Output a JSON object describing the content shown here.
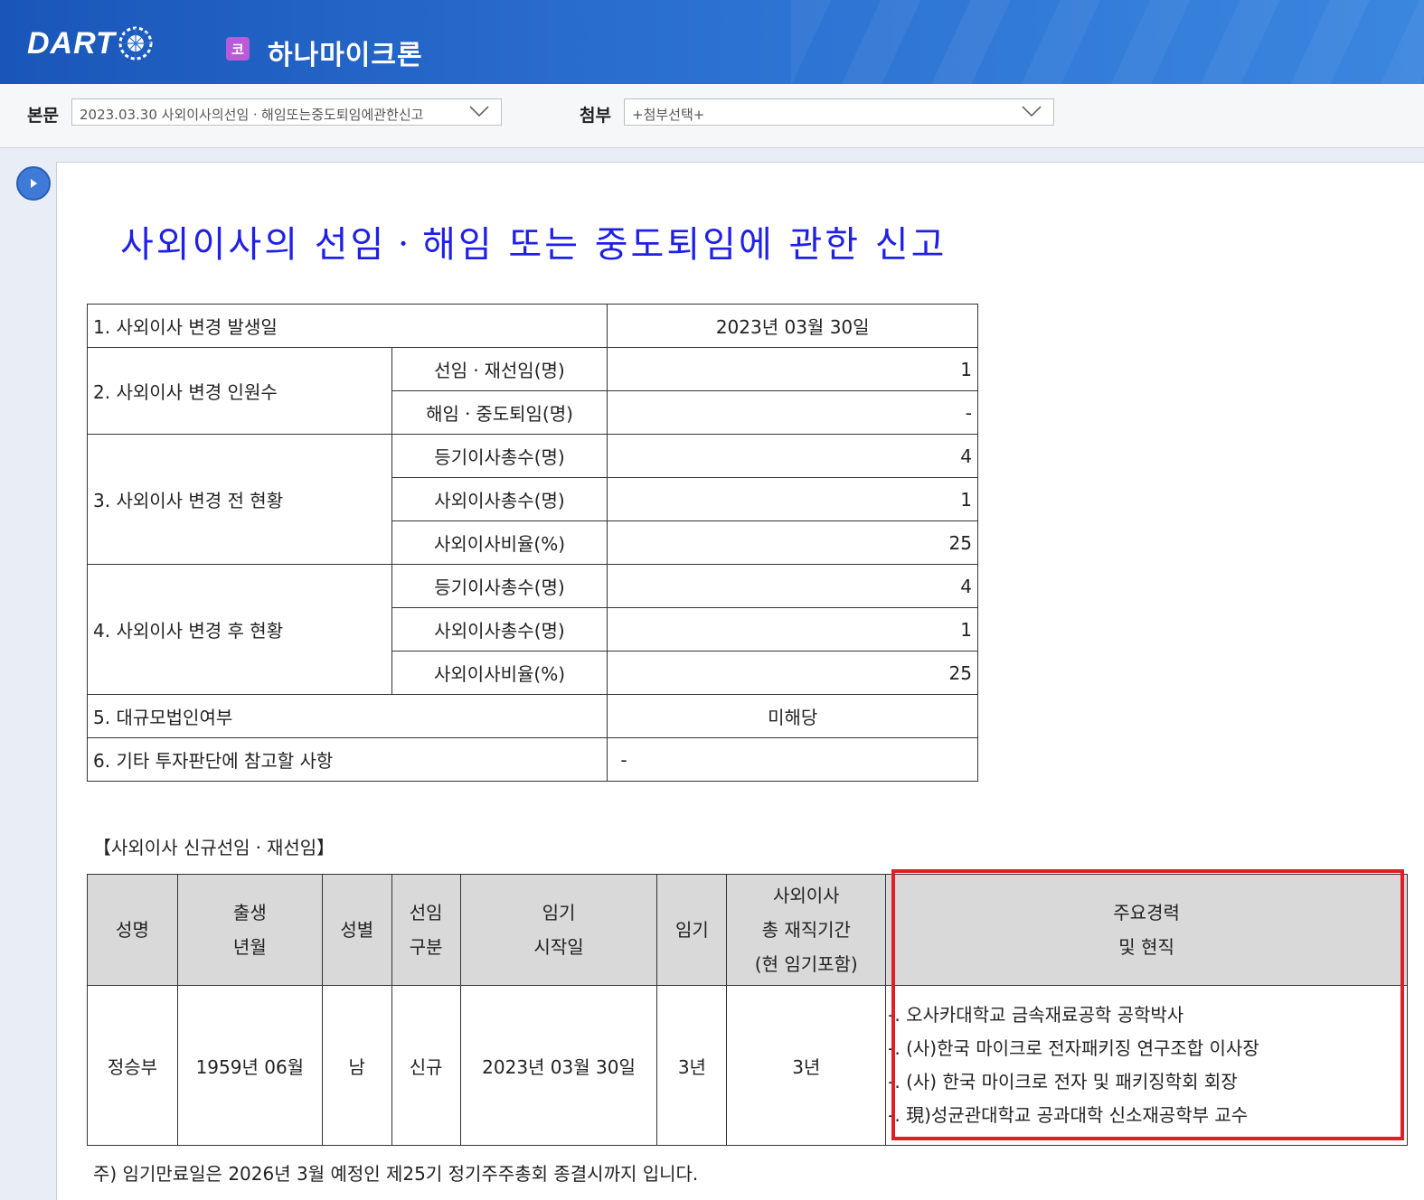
{
  "header": {
    "logo_text": "DART",
    "corp_badge": "코",
    "corp_name": "하나마이크론"
  },
  "toolbar": {
    "main_label": "본문",
    "main_select_value": "2023.03.30   사외이사의선임ㆍ해임또는중도퇴임에관한신고",
    "attach_label": "첨부",
    "attach_select_value": "+첨부선택+"
  },
  "document": {
    "title": "사외이사의 선임ㆍ해임 또는 중도퇴임에 관한 신고",
    "summary": {
      "row1_label": "1. 사외이사 변경 발생일",
      "row1_value": "2023년 03월 30일",
      "row2_label": "2. 사외이사 변경 인원수",
      "row2_sub1": "선임ㆍ재선임(명)",
      "row2_val1": "1",
      "row2_sub2": "해임ㆍ중도퇴임(명)",
      "row2_val2": "-",
      "row3_label": "3. 사외이사 변경 전 현황",
      "row3_sub1": "등기이사총수(명)",
      "row3_val1": "4",
      "row3_sub2": "사외이사총수(명)",
      "row3_val2": "1",
      "row3_sub3": "사외이사비율(%)",
      "row3_val3": "25",
      "row4_label": "4. 사외이사 변경 후 현황",
      "row4_sub1": "등기이사총수(명)",
      "row4_val1": "4",
      "row4_sub2": "사외이사총수(명)",
      "row4_val2": "1",
      "row4_sub3": "사외이사비율(%)",
      "row4_val3": "25",
      "row5_label": "5. 대규모법인여부",
      "row5_value": "미해당",
      "row6_label": "6. 기타 투자판단에 참고할 사항",
      "row6_value": "-"
    },
    "section_label": "【사외이사 신규선임ㆍ재선임】",
    "appointment_table": {
      "headers": {
        "name": "성명",
        "birth_1": "출생",
        "birth_2": "년월",
        "gender": "성별",
        "type_1": "선임",
        "type_2": "구분",
        "start_1": "임기",
        "start_2": "시작일",
        "term": "임기",
        "tenure_1": "사외이사",
        "tenure_2": "총 재직기간",
        "tenure_3": "(현 임기포함)",
        "career_1": "주요경력",
        "career_2": "및 현직"
      },
      "row": {
        "name": "정승부",
        "birth": "1959년 06월",
        "gender": "남",
        "type": "신규",
        "start": "2023년 03월 30일",
        "term": "3년",
        "tenure": "3년",
        "career": [
          "-. 오사카대학교 금속재료공학 공학박사",
          "-. (사)한국 마이크로 전자패키징 연구조합 이사장",
          "-. (사) 한국 마이크로 전자 및 패키징학회 회장",
          "-. 現)성균관대학교 공과대학 신소재공학부 교수"
        ]
      }
    },
    "footnote": "주) 임기만료일은 2026년 3월 예정인 제25기 정기주주총회 종결시까지 입니다."
  },
  "colors": {
    "header_blue": "#1a56b9",
    "title_blue": "#1f1fe6",
    "highlight_red": "#e01e25",
    "table_header_gray": "#d9d9d9"
  }
}
